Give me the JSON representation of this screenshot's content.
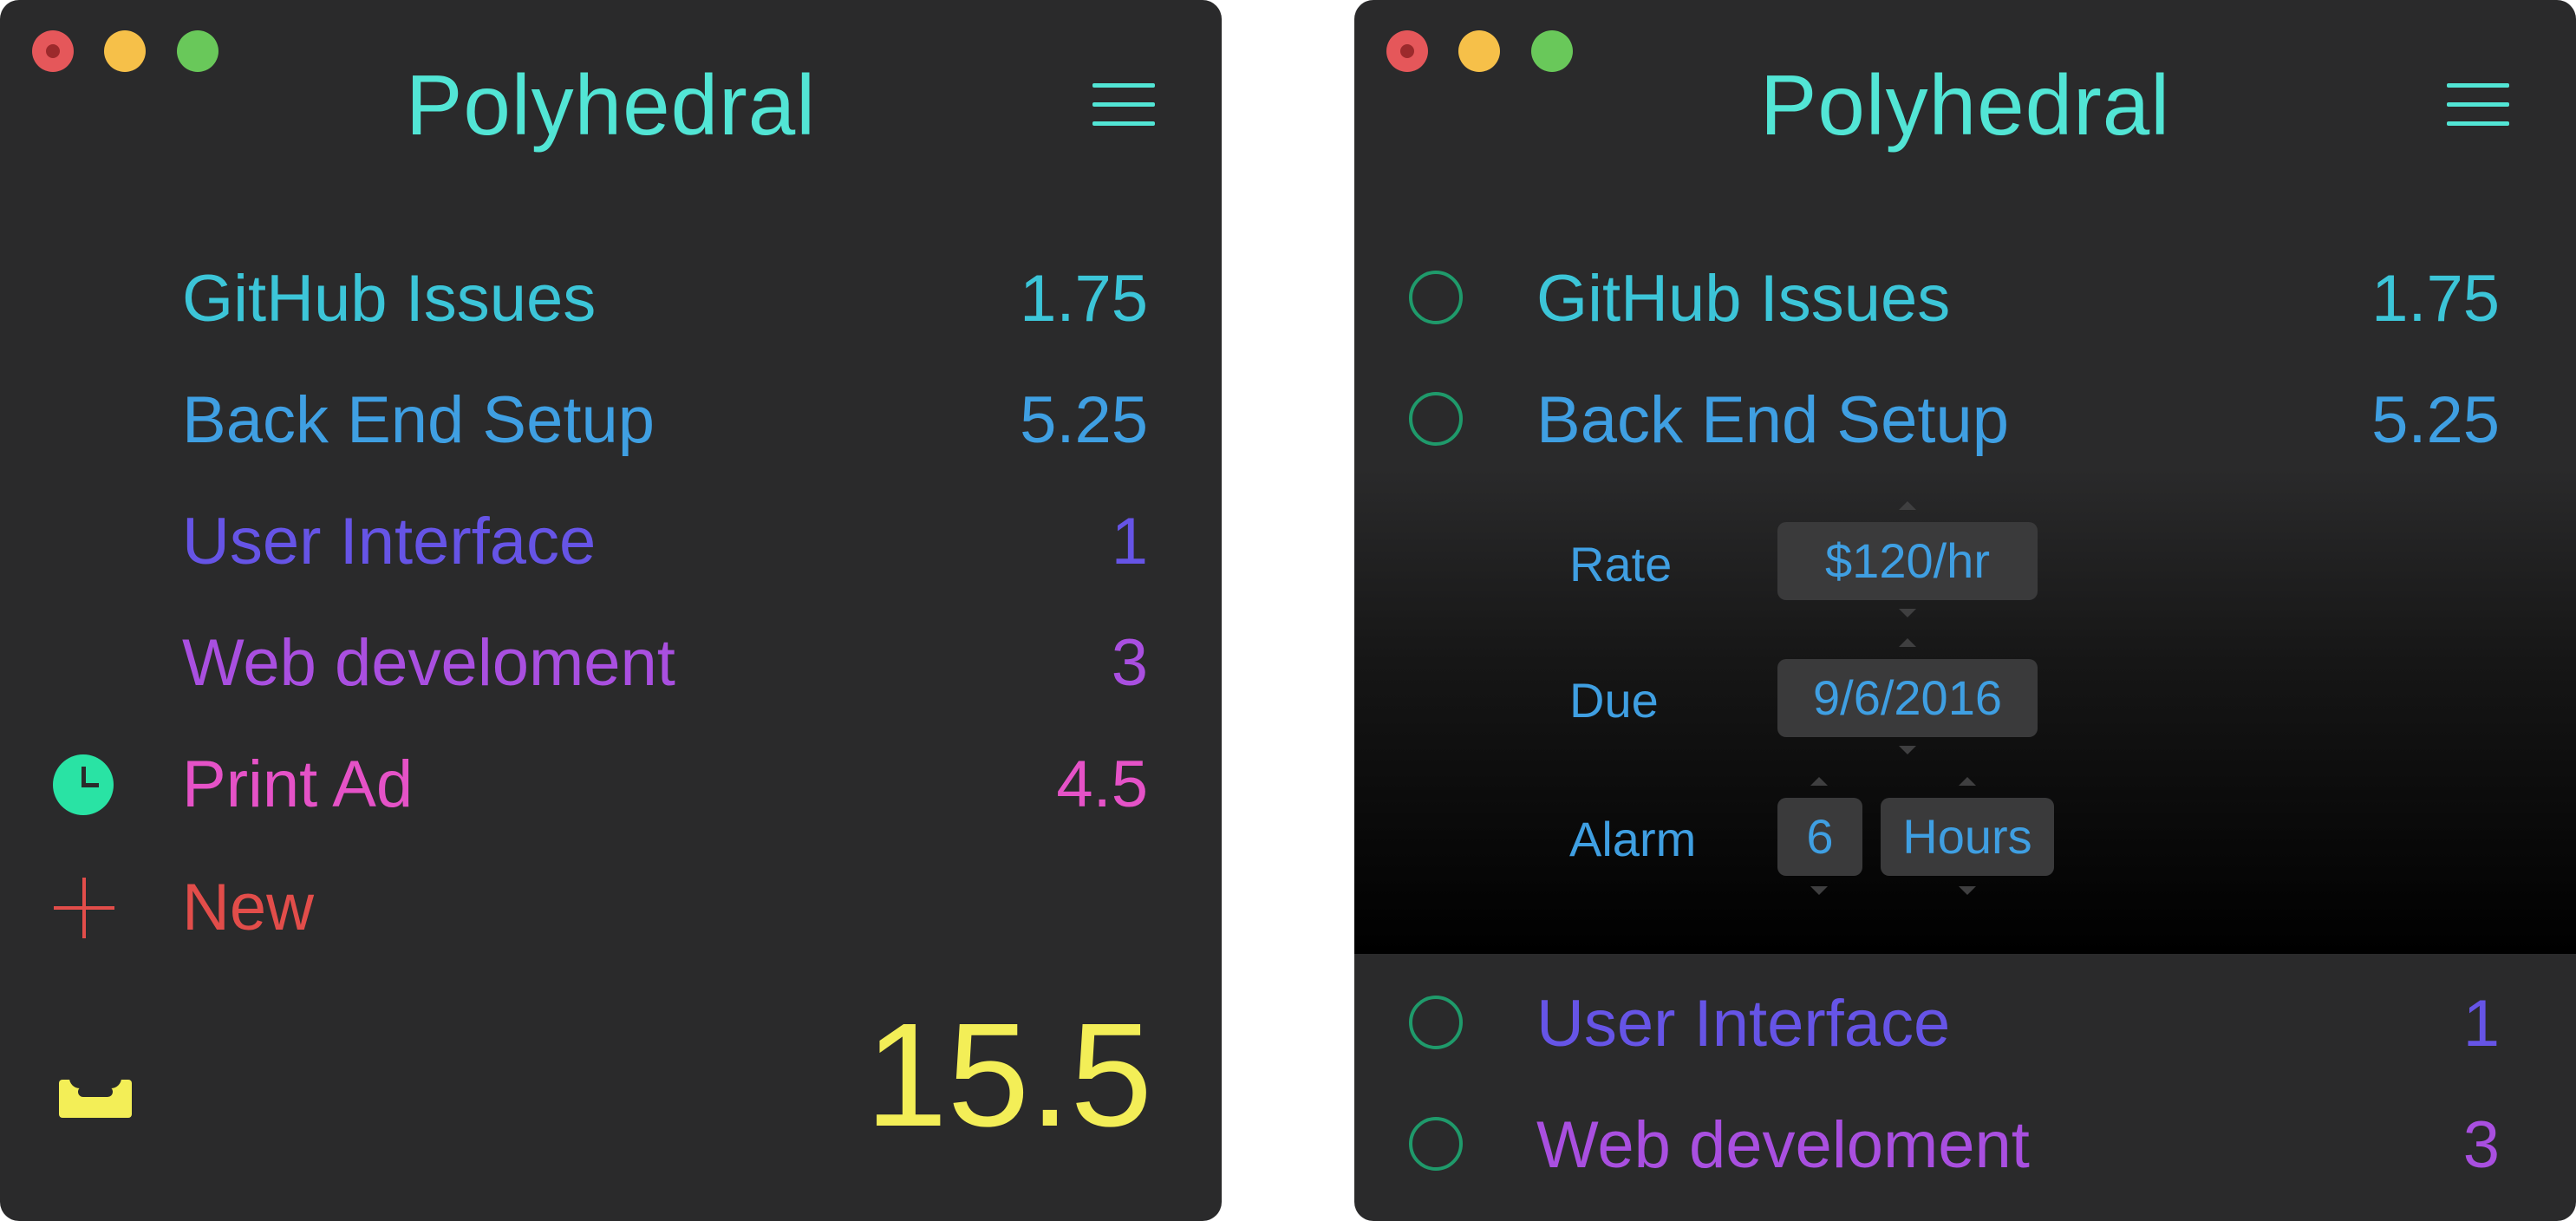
{
  "app_title": "Polyhedral",
  "colors": {
    "accent": "#52e5d5",
    "window_bg": "#2a2a2b",
    "total": "#f3ee57",
    "new": "#e24d4a",
    "timer": "#29e3a4"
  },
  "icons": {
    "menu": "hamburger-menu-icon",
    "timer": "clock-icon",
    "add": "plus-icon",
    "inbox": "inbox-icon",
    "task_toggle": "circle-icon"
  },
  "left_window": {
    "projects": [
      {
        "name": "GitHub Issues",
        "hours": "1.75",
        "color": "#3cc5d8"
      },
      {
        "name": "Back End Setup",
        "hours": "5.25",
        "color": "#3f9fe2"
      },
      {
        "name": "User Interface",
        "hours": "1",
        "color": "#6654e6"
      },
      {
        "name": "Web develoment",
        "hours": "3",
        "color": "#a94fe0"
      },
      {
        "name": "Print Ad",
        "hours": "4.5",
        "color": "#e552c7",
        "active_timer": true
      }
    ],
    "new_label": "New",
    "total": "15.5"
  },
  "right_window": {
    "projects": [
      {
        "name": "GitHub Issues",
        "hours": "1.75"
      },
      {
        "name": "Back End Setup",
        "hours": "5.25",
        "expanded": true
      },
      {
        "name": "User Interface",
        "hours": "1"
      },
      {
        "name": "Web develoment",
        "hours": "3"
      }
    ],
    "details": {
      "rate_label": "Rate",
      "rate_value": "$120/hr",
      "due_label": "Due",
      "due_value": "9/6/2016",
      "alarm_label": "Alarm",
      "alarm_amount": "6",
      "alarm_unit": "Hours"
    }
  }
}
